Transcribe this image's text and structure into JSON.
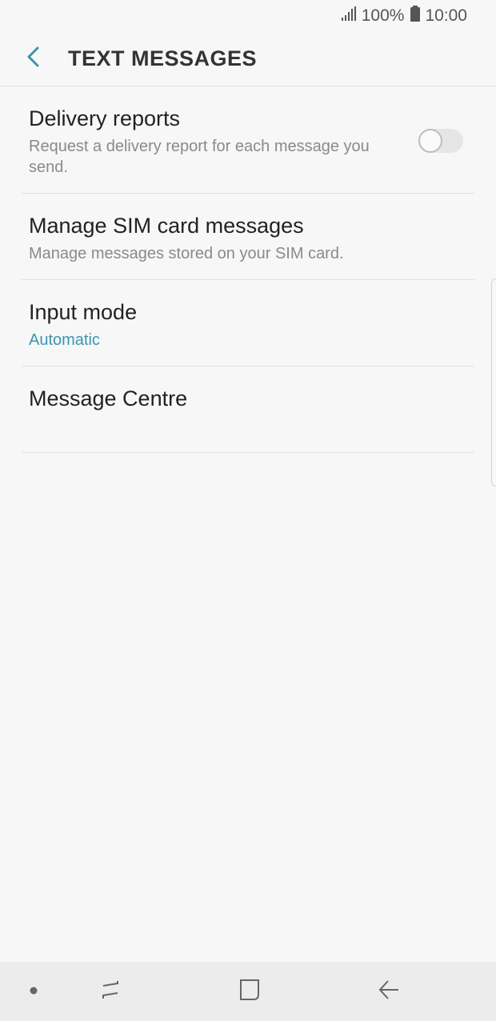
{
  "status_bar": {
    "signal_icon": "signal-icon",
    "battery_percent": "100%",
    "battery_icon": "battery-icon",
    "time": "10:00"
  },
  "header": {
    "back_icon": "chevron-left-icon",
    "title": "TEXT MESSAGES"
  },
  "settings": [
    {
      "title": "Delivery reports",
      "summary": "Request a delivery report for each message you send.",
      "toggle": {
        "on": false
      }
    },
    {
      "title": "Manage SIM card messages",
      "summary": "Manage messages stored on your SIM card."
    },
    {
      "title": "Input mode",
      "summary": "Automatic"
    },
    {
      "title": "Message Centre",
      "summary": ""
    }
  ],
  "nav_bar": {
    "items": [
      "dot-icon",
      "recent-apps-icon",
      "home-icon",
      "back-arrow-icon"
    ]
  },
  "colors": {
    "accent": "#3a95b0",
    "background": "#f7f7f7"
  }
}
